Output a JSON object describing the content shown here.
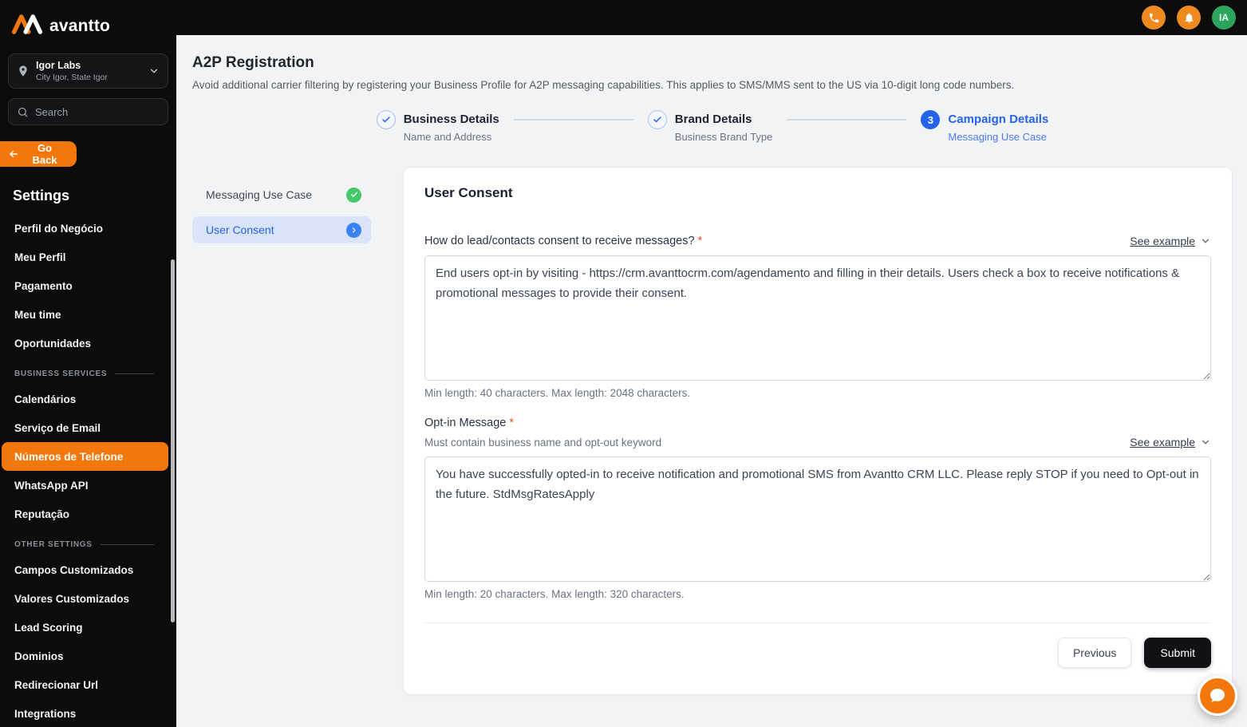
{
  "colors": {
    "accent_orange": "#f4770c",
    "accent_blue": "#2563eb",
    "success_green": "#43c96c",
    "avatar_green": "#2ca45d",
    "topbar_icon_orange": "#ef8a1f",
    "required_mark": "#f4511e",
    "sidebar_bg": "#0c0c0d",
    "active_subnav_bg": "#d9e4fb"
  },
  "icons": {
    "logo": "avantto-logo-icon",
    "location": "location-pin-icon",
    "search": "search-icon",
    "filter": "filter-icon",
    "back": "back-arrow-icon",
    "chevron_down": "chevron-down-icon",
    "chevron_right": "chevron-right-icon",
    "check": "check-icon",
    "phone": "phone-icon",
    "bell": "bell-icon",
    "chat": "chat-icon"
  },
  "brand": {
    "logo_text": "avantto"
  },
  "topbar": {
    "avatar_initials": "IA"
  },
  "sidebar": {
    "location": {
      "name": "Igor Labs",
      "subtitle": "City Igor, State Igor"
    },
    "search_placeholder": "Search",
    "go_back_label": "Go Back",
    "settings_title": "Settings",
    "items_top": [
      {
        "label": "Perfil do Negócio"
      },
      {
        "label": "Meu Perfil"
      },
      {
        "label": "Pagamento"
      },
      {
        "label": "Meu time"
      },
      {
        "label": "Oportunidades"
      }
    ],
    "section_business": "BUSINESS SERVICES",
    "items_business": [
      {
        "label": "Calendários"
      },
      {
        "label": "Serviço de Email"
      },
      {
        "label": "Números de Telefone"
      },
      {
        "label": "WhatsApp API"
      },
      {
        "label": "Reputação"
      }
    ],
    "section_other": "OTHER SETTINGS",
    "items_other": [
      {
        "label": "Campos Customizados"
      },
      {
        "label": "Valores Customizados"
      },
      {
        "label": "Lead Scoring"
      },
      {
        "label": "Dominios"
      },
      {
        "label": "Redirecionar Url"
      },
      {
        "label": "Integrations"
      }
    ]
  },
  "page": {
    "title": "A2P Registration",
    "subtitle": "Avoid additional carrier filtering by registering your Business Profile for A2P messaging capabilities. This applies to SMS/MMS sent to the US via 10-digit long code numbers."
  },
  "stepper": {
    "steps": [
      {
        "title": "Business Details",
        "subtitle": "Name and Address",
        "state": "done"
      },
      {
        "title": "Brand Details",
        "subtitle": "Business Brand Type",
        "state": "done"
      },
      {
        "number": "3",
        "title": "Campaign Details",
        "subtitle": "Messaging Use Case",
        "state": "current"
      }
    ]
  },
  "subnav": {
    "items": [
      {
        "label": "Messaging Use Case",
        "state": "complete"
      },
      {
        "label": "User Consent",
        "state": "active"
      }
    ]
  },
  "form": {
    "title": "User Consent",
    "consent_field": {
      "label": "How do lead/contacts consent to receive messages?",
      "required_mark": "*",
      "see_example_label": "See example",
      "value": "End users opt-in by visiting - https://crm.avanttocrm.com/agendamento and filling in their details. Users check a box to receive notifications & promotional messages to provide their consent.",
      "hint": "Min length: 40 characters. Max length: 2048 characters."
    },
    "optin_field": {
      "label": "Opt-in Message",
      "required_mark": "*",
      "sublabel": "Must contain business name and opt-out keyword",
      "see_example_label": "See example",
      "value": "You have successfully opted-in to receive notification and promotional SMS from Avantto CRM LLC. Please reply STOP if you need to Opt-out in the future. StdMsgRatesApply",
      "hint": "Min length: 20 characters. Max length: 320 characters."
    },
    "previous_label": "Previous",
    "submit_label": "Submit"
  }
}
